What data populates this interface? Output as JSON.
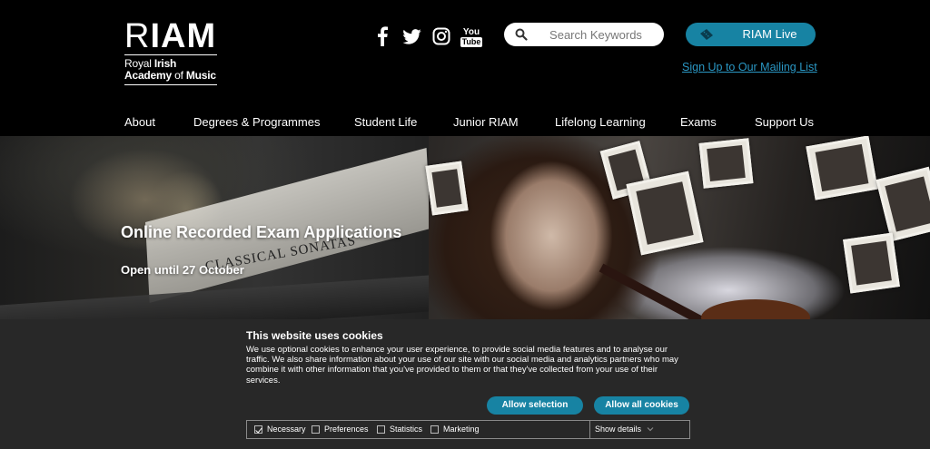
{
  "logo": {
    "mark_r": "R",
    "mark_iam": "IAM",
    "line1_a": "Royal ",
    "line1_b": "Irish",
    "line2_a": "Academy ",
    "line2_b": "of ",
    "line2_c": "Music"
  },
  "social": {
    "youtube_line1": "You",
    "youtube_line2": "Tube"
  },
  "search": {
    "placeholder": "Search Keywords"
  },
  "header": {
    "live_label": "RIAM Live",
    "mailing_label": "Sign Up to Our Mailing List"
  },
  "nav": {
    "items": [
      "About",
      "Degrees & Programmes",
      "Student Life",
      "Junior RIAM",
      "Lifelong Learning",
      "Exams",
      "Support Us"
    ]
  },
  "hero": {
    "title": "Online Recorded Exam Applications",
    "subtitle": "Open until 27 October",
    "stand_text": "CLASSICAL SONATAS"
  },
  "cookie": {
    "heading": "This website uses cookies",
    "body": "We use optional cookies to enhance your user experience, to provide social media features and to analyse our traffic. We also share information about your use of our site with our social media and analytics partners who may combine it with other information that you've provided to them or that they've collected from your use of their services.",
    "allow_selection": "Allow selection",
    "allow_all": "Allow all cookies",
    "options": [
      "Necessary",
      "Preferences",
      "Statistics",
      "Marketing"
    ],
    "show_details": "Show details"
  },
  "colors": {
    "accent": "#1783a3",
    "link": "#2a97c4",
    "banner_bg": "#282828"
  }
}
